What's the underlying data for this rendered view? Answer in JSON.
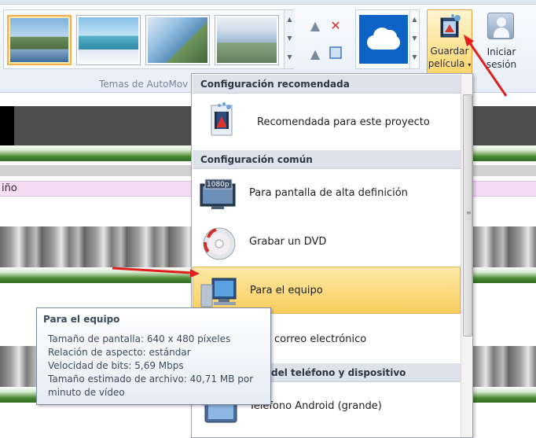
{
  "ribbon": {
    "themes_group_label": "Temas de AutoMov",
    "save_movie_label_line1": "Guardar",
    "save_movie_label_line2": "película",
    "sign_in_label_line1": "Iniciar",
    "sign_in_label_line2": "sesión"
  },
  "timeline": {
    "caption_text": "iño"
  },
  "menu": {
    "sections": [
      {
        "header": "Configuración recomendada"
      },
      {
        "header": "Configuración común"
      },
      {
        "header": "del teléfono y dispositivo"
      }
    ],
    "items": [
      {
        "label": "Recomendada para este proyecto",
        "icon": "film-recommended-icon"
      },
      {
        "label": "Para pantalla de alta definición",
        "icon": "hd-display-icon",
        "badge": "1080p"
      },
      {
        "label": "Grabar un DVD",
        "icon": "dvd-icon"
      },
      {
        "label": "Para el equipo",
        "icon": "computer-icon"
      },
      {
        "label": "correo electrónico",
        "icon": "email-icon"
      },
      {
        "label": "Teléfono Android (grande)",
        "icon": "android-phone-icon"
      }
    ]
  },
  "tooltip": {
    "title": "Para el equipo",
    "lines": [
      "Tamaño de pantalla: 640 x 480 píxeles",
      "Relación de aspecto: estándar",
      "Velocidad de bits: 5,69 Mbps",
      "Tamaño estimado de archivo: 40,71 MB por",
      "minuto de vídeo"
    ]
  },
  "colors": {
    "accent_highlight": "#f9cd5d",
    "annotation_arrow": "#e01f1f",
    "onedrive_blue": "#0d64c5"
  }
}
